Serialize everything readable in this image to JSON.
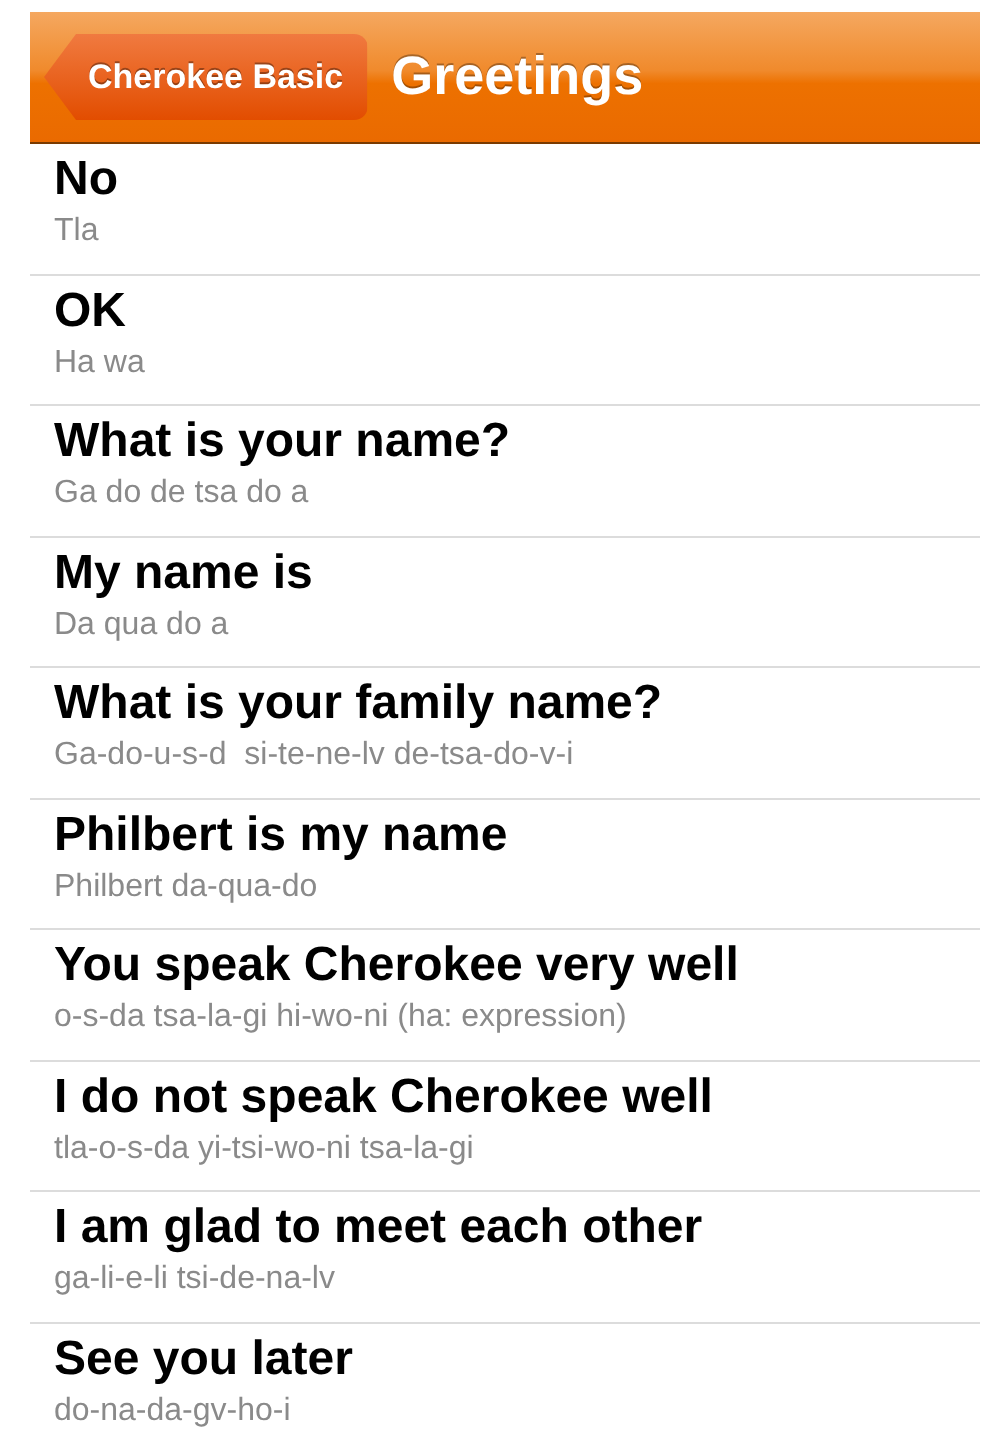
{
  "nav_bar": {
    "back_button": "Cherokee Basic",
    "title": "Greetings"
  },
  "phrases": [
    {
      "english": "No",
      "cherokee": "Tla"
    },
    {
      "english": "OK",
      "cherokee": "Ha wa"
    },
    {
      "english": "What is your name?",
      "cherokee": "Ga do de tsa do a"
    },
    {
      "english": "My name is",
      "cherokee": "Da qua do a"
    },
    {
      "english": "What is your family name?",
      "cherokee": "Ga-do-u-s-d  si-te-ne-lv de-tsa-do-v-i"
    },
    {
      "english": "Philbert is my name",
      "cherokee": "Philbert da-qua-do"
    },
    {
      "english": "You speak Cherokee very well",
      "cherokee": "o-s-da tsa-la-gi hi-wo-ni (ha: expression)"
    },
    {
      "english": "I do not speak Cherokee well",
      "cherokee": "tla-o-s-da yi-tsi-wo-ni tsa-la-gi"
    },
    {
      "english": "I am glad to meet each other",
      "cherokee": "ga-li-e-li tsi-de-na-lv"
    },
    {
      "english": "See you later",
      "cherokee": "do-na-da-gv-ho-i"
    }
  ]
}
